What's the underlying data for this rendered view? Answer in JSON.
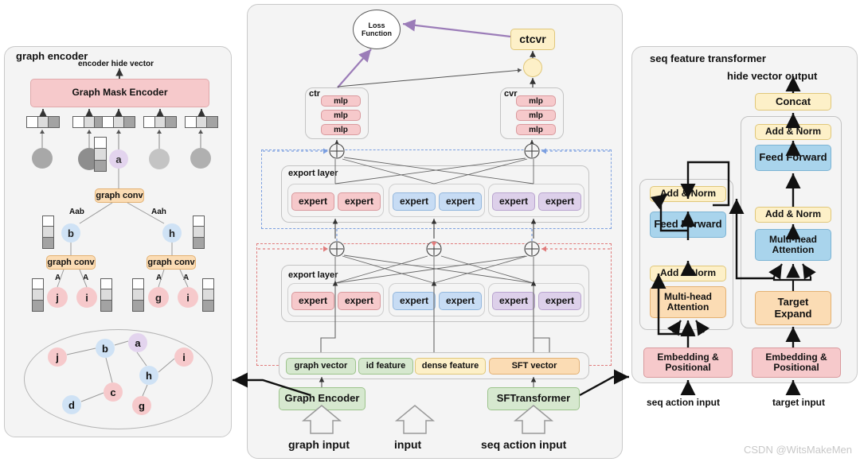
{
  "watermark": "CSDN @WitsMakeMen",
  "colors": {
    "panel_bg": "#f4f4f4",
    "pink": "#f6c9cb",
    "pink_border": "#d99a9e",
    "blue": "#c7dcf4",
    "blue_border": "#93b7dd",
    "purple": "#ddd0ea",
    "purple_border": "#b9a4cf",
    "green": "#d6e8cf",
    "green_border": "#9dc48c",
    "yellow": "#fdf0c8",
    "yellow_border": "#e0c77a",
    "orange": "#fbdcb4",
    "orange_border": "#e3b173",
    "dashed_blue": "#7b9fe0",
    "dashed_red": "#e07b7b",
    "loss_arrow": "#9b7cb8"
  },
  "left_panel": {
    "title": "graph encoder",
    "encoder_hide_vector": "encoder hide vector",
    "mask_encoder": "Graph Mask Encoder",
    "graph_conv": "graph conv",
    "edge_labels": {
      "aab": "Aab",
      "aah": "Aah",
      "a1": "A",
      "a2": "A",
      "a3": "A",
      "a4": "A"
    },
    "mid_nodes": [
      "b",
      "h"
    ],
    "leaf_nodes": [
      "j",
      "i",
      "g",
      "i"
    ],
    "center_node": "a",
    "graph_nodes": [
      {
        "id": "j",
        "color": "pink"
      },
      {
        "id": "b",
        "color": "blue"
      },
      {
        "id": "a",
        "color": "purple"
      },
      {
        "id": "i",
        "color": "pink"
      },
      {
        "id": "h",
        "color": "blue"
      },
      {
        "id": "c",
        "color": "pink"
      },
      {
        "id": "d",
        "color": "blue"
      },
      {
        "id": "g",
        "color": "pink"
      }
    ]
  },
  "center_panel": {
    "loss_function": "Loss\nFunction",
    "loss_function_line1": "Loss",
    "loss_function_line2": "Function",
    "ctcvr": "ctcvr",
    "ctr_title": "ctr",
    "cvr_title": "cvr",
    "mlp": "mlp",
    "mlp_list": [
      "mlp",
      "mlp",
      "mlp"
    ],
    "export_layer": "export layer",
    "expert": "expert",
    "expert_groups": [
      {
        "color": "pink",
        "experts": [
          "expert",
          "expert"
        ]
      },
      {
        "color": "blue",
        "experts": [
          "expert",
          "expert"
        ]
      },
      {
        "color": "purple",
        "experts": [
          "expert",
          "expert"
        ]
      }
    ],
    "feature_vectors": [
      {
        "label": "graph vector",
        "color": "green"
      },
      {
        "label": "id feature",
        "color": "green"
      },
      {
        "label": "dense feature",
        "color": "yellow"
      },
      {
        "label": "SFT  vector",
        "color": "orange"
      }
    ],
    "graph_encoder": "Graph Encoder",
    "sftransformer": "SFTransformer",
    "inputs": [
      "graph input",
      "input",
      "seq action input"
    ]
  },
  "right_panel": {
    "title": "seq feature transformer",
    "hide_vector_output": "hide vector output",
    "concat": "Concat",
    "add_norm": "Add & Norm",
    "feed_forward": "Feed Forward",
    "multi_head_attention": "Multi-head\nAttention",
    "multi_head_line1": "Multi-head",
    "multi_head_line2": "Attention",
    "target_expand_line1": "Target",
    "target_expand_line2": "Expand",
    "embedding_positional_line1": "Embedding &",
    "embedding_positional_line2": "Positional",
    "seq_action_input": "seq action input",
    "target_input": "target input"
  }
}
